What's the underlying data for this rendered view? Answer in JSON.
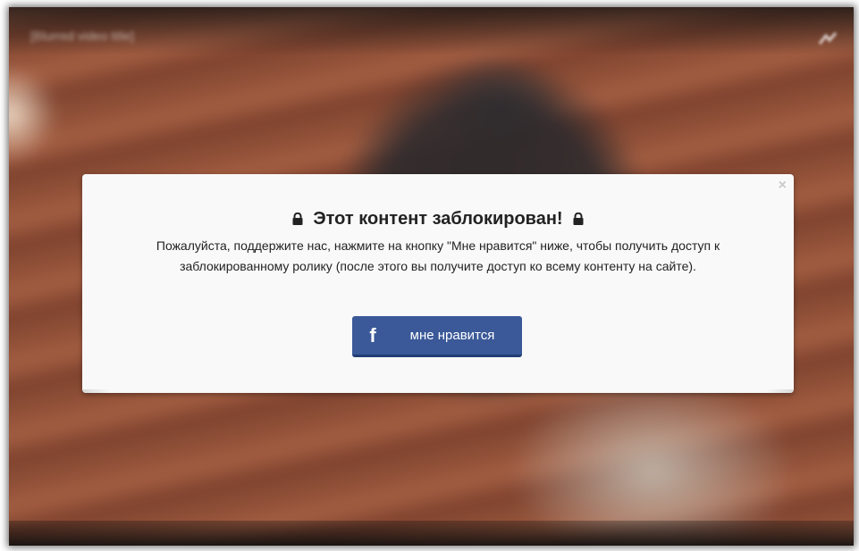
{
  "video": {
    "title": "[Blurred video title]",
    "share_icon": "share-icon"
  },
  "modal": {
    "close_label": "×",
    "title": "Этот контент заблокирован!",
    "lock_icon": "lock-icon",
    "message": "Пожалуйста, поддержите нас, нажмите на кнопку \"Мне нравится\" ниже, чтобы получить доступ к заблокированному ролику (после этого вы получите доступ ко всему контенту на сайте).",
    "like_button": {
      "icon": "facebook-icon",
      "icon_glyph": "f",
      "label": "мне нравится",
      "color": "#3b5998"
    }
  }
}
